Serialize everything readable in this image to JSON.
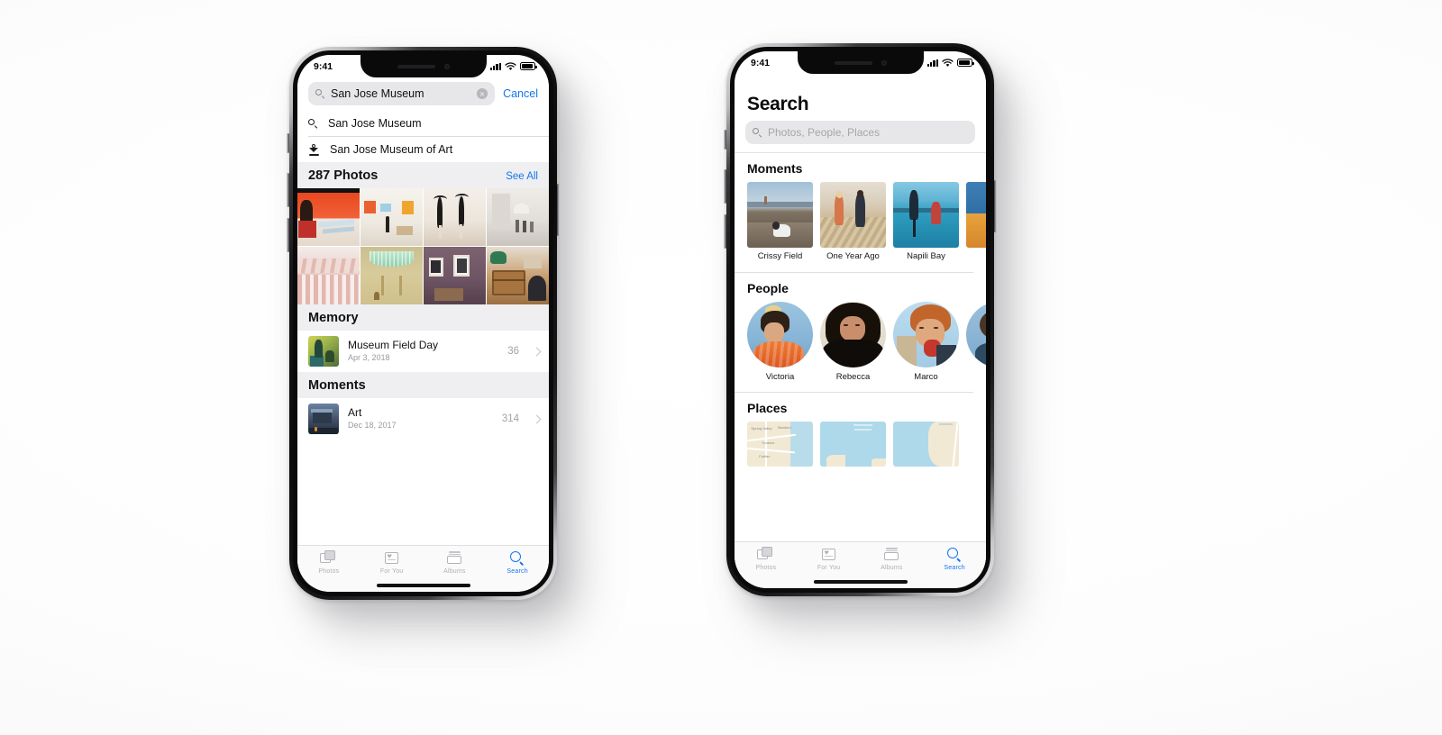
{
  "scene": {
    "background": "#ffffff",
    "device_count": 2,
    "description": "Two iPhone X devices showing the iOS Photos app Search experience"
  },
  "accent": {
    "blue": "#1476ef",
    "group_header_bg": "#efeff2",
    "search_field_bg": "#e7e7ea",
    "secondary_text": "#9a9aa0"
  },
  "phone_left": {
    "status_bar": {
      "time": "9:41",
      "cellular": "signal-bars",
      "wifi": "wifi-icon",
      "battery": "battery-icon"
    },
    "search": {
      "value": "San Jose Museum",
      "placeholder": "Photos, People, Places",
      "clear_label": "Clear",
      "cancel_label": "Cancel",
      "icon": "search-icon"
    },
    "suggestions": [
      {
        "label": "San Jose Museum",
        "icon": "search-icon"
      },
      {
        "label": "San Jose Museum of Art",
        "icon": "landmark-pin-icon"
      }
    ],
    "photos_section": {
      "title": "287 Photos",
      "count": 287,
      "see_all_label": "See All",
      "grid": [
        {
          "name": "red-abstract-painting",
          "c1": "#d8472c",
          "c2": "#f05a32",
          "c3": "#ffffff"
        },
        {
          "name": "gallery-white-wall-artworks",
          "c1": "#f2efe9",
          "c2": "#e6e0d6",
          "c3": "#f29a3a"
        },
        {
          "name": "two-ballet-dancers",
          "c1": "#efe9e2",
          "c2": "#d8cfc4",
          "c3": "#1a1a1a"
        },
        {
          "name": "museum-atrium-visitors",
          "c1": "#e7e4e0",
          "c2": "#cfcbc6",
          "c3": "#8e8a86"
        },
        {
          "name": "pink-columned-facade",
          "c1": "#e9d3cf",
          "c2": "#d9a9a1",
          "c3": "#f2e7e3"
        },
        {
          "name": "green-glass-ceiling-hall",
          "c1": "#c8bb8c",
          "c2": "#b7e0c4",
          "c3": "#e4d9ad"
        },
        {
          "name": "framed-photographs-purple-wall",
          "c1": "#7d6270",
          "c2": "#6a5260",
          "c3": "#f4f1ec"
        },
        {
          "name": "vintage-luggage-exhibit",
          "c1": "#a8764a",
          "c2": "#8a5d36",
          "c3": "#2d6b4a"
        }
      ]
    },
    "memory_section": {
      "header": "Memory",
      "rows": [
        {
          "title": "Museum Field Day",
          "subtitle": "Apr 3, 2018",
          "count": "36",
          "thumb": {
            "name": "field-day-silhouette",
            "c1": "#b9c24a",
            "c2": "#5d7b3c",
            "c3": "#1f3d2b"
          }
        }
      ]
    },
    "moments_section": {
      "header": "Moments",
      "rows": [
        {
          "title": "Art",
          "subtitle": "Dec 18, 2017",
          "count": "314",
          "thumb": {
            "name": "museum-at-dusk",
            "c1": "#5a6f88",
            "c2": "#2c3a4c",
            "c3": "#d98a3a"
          }
        }
      ]
    },
    "tabs": [
      {
        "label": "Photos",
        "icon": "photos-icon",
        "active": false
      },
      {
        "label": "For You",
        "icon": "for-you-icon",
        "active": false
      },
      {
        "label": "Albums",
        "icon": "albums-icon",
        "active": false
      },
      {
        "label": "Search",
        "icon": "search-icon",
        "active": true
      }
    ]
  },
  "phone_right": {
    "status_bar": {
      "time": "9:41",
      "cellular": "signal-bars",
      "wifi": "wifi-icon",
      "battery": "battery-icon"
    },
    "page_title": "Search",
    "search": {
      "placeholder": "Photos, People, Places",
      "value": "",
      "icon": "search-icon"
    },
    "moments_section": {
      "title": "Moments",
      "items": [
        {
          "label": "Crissy Field",
          "thumb": {
            "name": "dog-running-on-beach-golden-gate",
            "sky": "#b9cddd",
            "land": "#8a7d6c",
            "water": "#9fb6c4"
          }
        },
        {
          "label": "One Year Ago",
          "thumb": {
            "name": "couple-walking-on-pebble-beach",
            "sky": "#dfd8cb",
            "land": "#c9b48f",
            "water": "#cfc3ab"
          }
        },
        {
          "label": "Napili Bay",
          "thumb": {
            "name": "kite-surfers-in-ocean",
            "sky": "#7fc6e0",
            "land": "#1f7fa0",
            "water": "#2a93b8"
          }
        },
        {
          "label": "",
          "thumb": {
            "name": "partial-next-moment",
            "sky": "#2f6fa8",
            "land": "#e8a33c",
            "water": "#2f6fa8"
          }
        }
      ]
    },
    "people_section": {
      "title": "People",
      "items": [
        {
          "label": "Victoria",
          "avatar": {
            "name": "victoria-avatar",
            "bg": "#9ec4df",
            "hair": "#3a2a1e",
            "cloth": "#e8642a"
          }
        },
        {
          "label": "Rebecca",
          "avatar": {
            "name": "rebecca-avatar",
            "bg": "#e3ddd0",
            "hair": "#1d1510",
            "cloth": "#14100e"
          }
        },
        {
          "label": "Marco",
          "avatar": {
            "name": "marco-avatar",
            "bg": "#b7d8ea",
            "hair": "#c1632a",
            "cloth": "#c33a2a"
          }
        },
        {
          "label": "",
          "avatar": {
            "name": "partial-next-person",
            "bg": "#8fb8d6",
            "hair": "#4a3425",
            "cloth": "#2d4a63"
          }
        }
      ]
    },
    "places_section": {
      "title": "Places",
      "items": [
        {
          "name": "bay-area-map-thumb",
          "land": "#efe6d0",
          "water": "#b9dcea",
          "road": "#ffffff"
        },
        {
          "name": "coastal-water-map-thumb",
          "land": "#efe6d0",
          "water": "#aed9ea",
          "road": "#ffffff"
        },
        {
          "name": "peninsula-map-thumb",
          "land": "#efe6d0",
          "water": "#aed9ea",
          "road": "#ffffff"
        }
      ]
    },
    "tabs": [
      {
        "label": "Photos",
        "icon": "photos-icon",
        "active": false
      },
      {
        "label": "For You",
        "icon": "for-you-icon",
        "active": false
      },
      {
        "label": "Albums",
        "icon": "albums-icon",
        "active": false
      },
      {
        "label": "Search",
        "icon": "search-icon",
        "active": true
      }
    ]
  }
}
